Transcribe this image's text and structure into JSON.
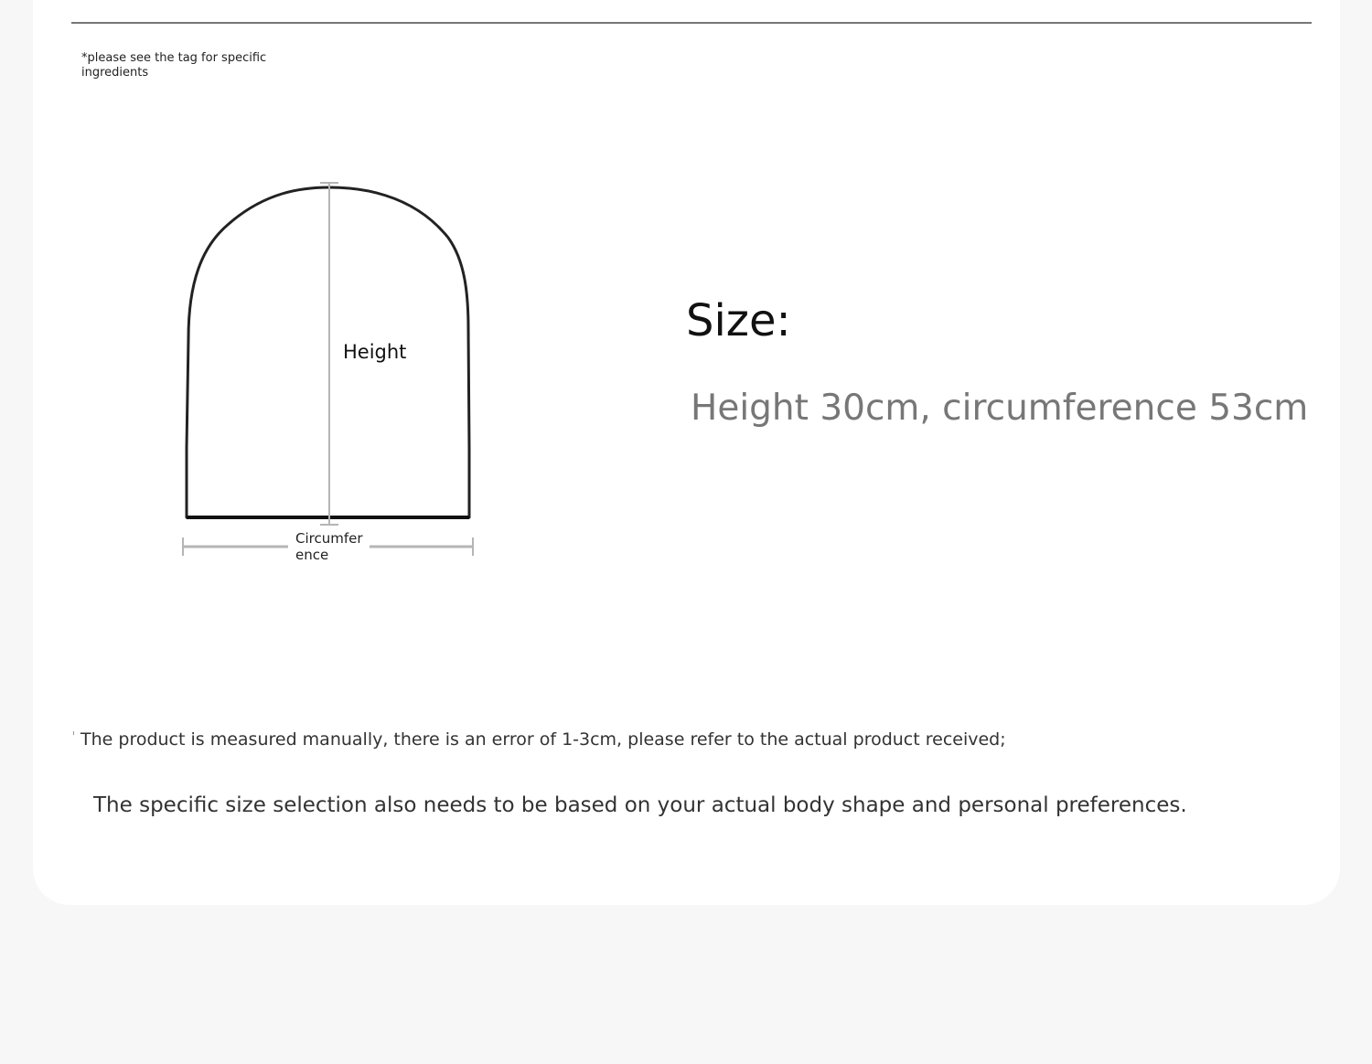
{
  "tag_note": "*please see the tag for specific ingredients",
  "diagram": {
    "height_label": "Height",
    "circumference_label": "Circumference",
    "outline_color": "#222222",
    "measure_color": "#b5b5b5"
  },
  "size": {
    "heading": "Size:",
    "value": "Height 30cm, circumference 53cm"
  },
  "notes": {
    "line1": "The product is measured manually, there is an error of 1-3cm, please refer to the actual product received;",
    "line2": "The specific size selection also needs to be based on your actual body shape and personal preferences."
  }
}
